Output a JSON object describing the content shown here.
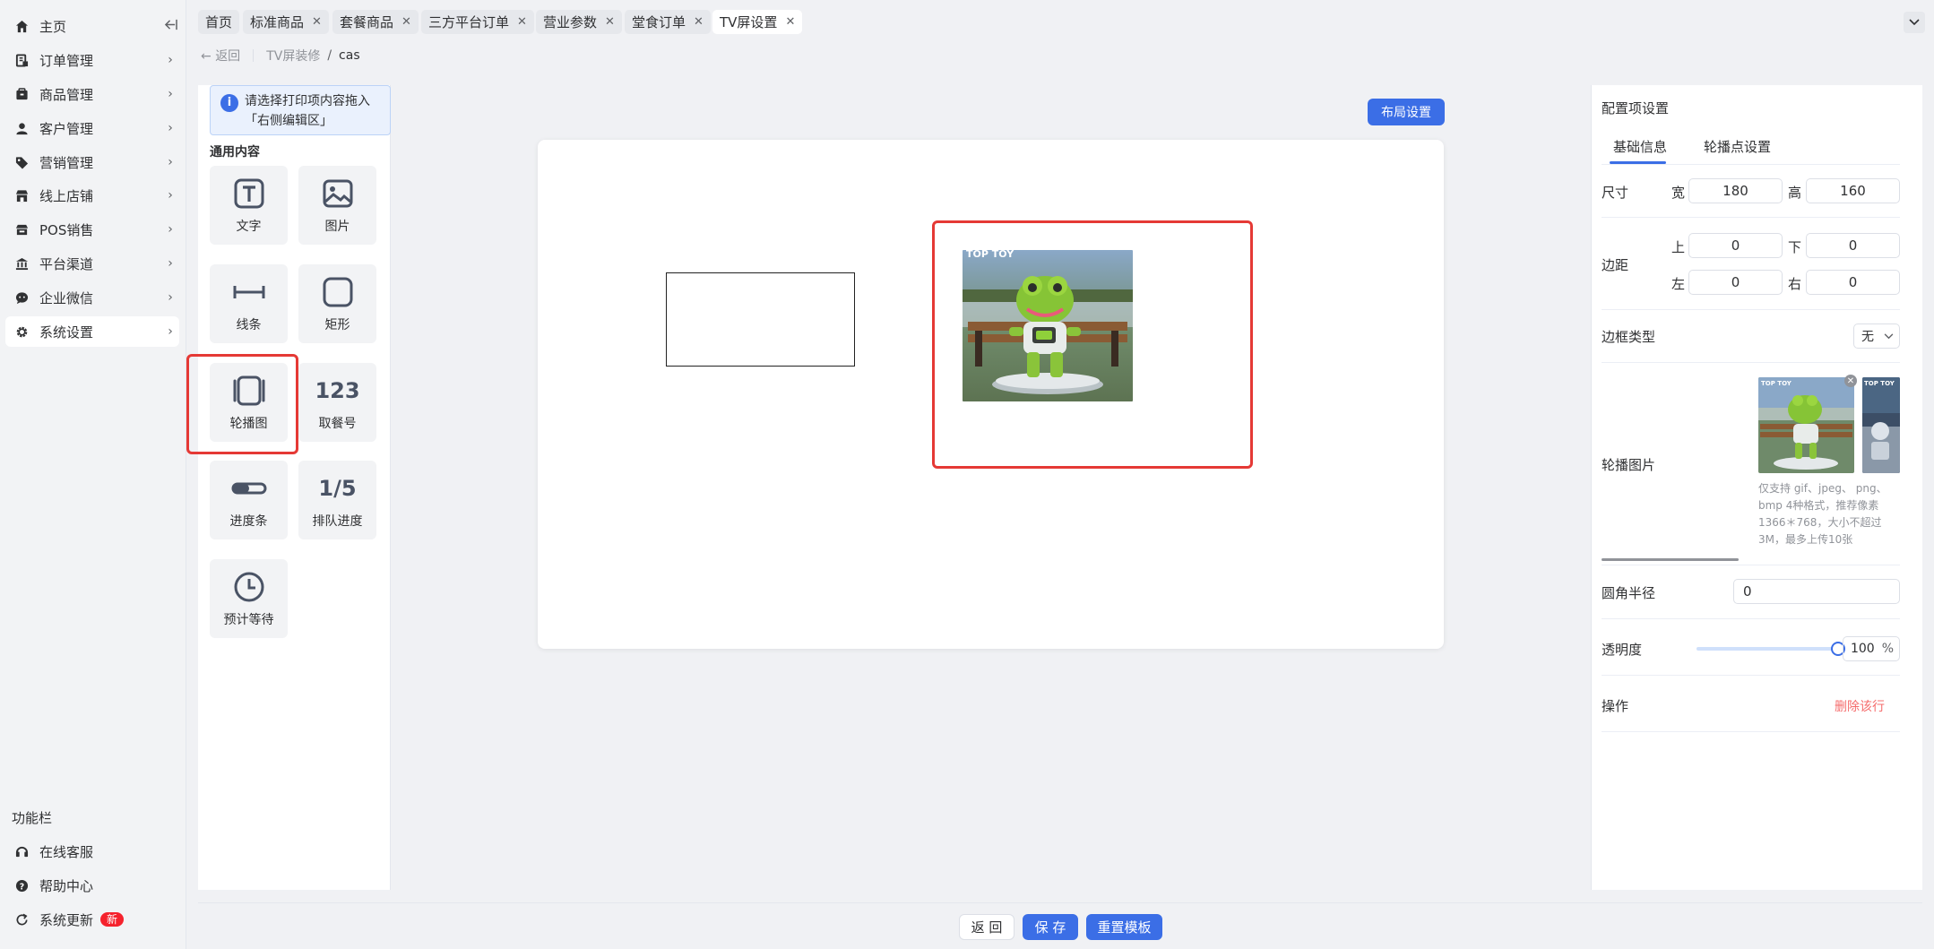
{
  "sidebar": {
    "items": [
      {
        "label": "主页",
        "icon": "home-icon"
      },
      {
        "label": "订单管理",
        "icon": "order-icon"
      },
      {
        "label": "商品管理",
        "icon": "goods-icon"
      },
      {
        "label": "客户管理",
        "icon": "user-icon"
      },
      {
        "label": "营销管理",
        "icon": "tag-icon"
      },
      {
        "label": "线上店铺",
        "icon": "store-icon"
      },
      {
        "label": "POS销售",
        "icon": "pos-icon"
      },
      {
        "label": "平台渠道",
        "icon": "bank-icon"
      },
      {
        "label": "企业微信",
        "icon": "wechat-icon"
      },
      {
        "label": "系统设置",
        "icon": "gear-icon"
      }
    ],
    "func_title": "功能栏",
    "func_items": [
      {
        "label": "在线客服"
      },
      {
        "label": "帮助中心"
      },
      {
        "label": "系统更新",
        "badge": "新"
      }
    ]
  },
  "tabs": [
    {
      "label": "首页"
    },
    {
      "label": "标准商品"
    },
    {
      "label": "套餐商品"
    },
    {
      "label": "三方平台订单"
    },
    {
      "label": "营业参数"
    },
    {
      "label": "堂食订单"
    },
    {
      "label": "TV屏设置"
    }
  ],
  "breadcrumb": {
    "back": "返回",
    "parent": "TV屏装修",
    "separator": "/",
    "current": "cas"
  },
  "components": {
    "hint": "请选择打印项内容拖入「右侧编辑区」",
    "section_title": "通用内容",
    "items": [
      {
        "label": "文字",
        "icon": "text-icon"
      },
      {
        "label": "图片",
        "icon": "image-icon"
      },
      {
        "label": "线条",
        "icon": "line-icon"
      },
      {
        "label": "矩形",
        "icon": "rectangle-icon"
      },
      {
        "label": "轮播图",
        "icon": "carousel-icon"
      },
      {
        "label": "取餐号",
        "icon": "number-icon",
        "glyph": "123"
      },
      {
        "label": "进度条",
        "icon": "progress-icon"
      },
      {
        "label": "排队进度",
        "icon": "queue-icon",
        "glyph": "1/5"
      },
      {
        "label": "预计等待",
        "icon": "clock-icon"
      }
    ]
  },
  "canvas": {
    "layout_button": "布局设置",
    "carousel_logo": "TOP TOY"
  },
  "config": {
    "title": "配置项设置",
    "tabs": [
      "基础信息",
      "轮播点设置"
    ],
    "size_label": "尺寸",
    "width_label": "宽",
    "width_value": "180",
    "height_label": "高",
    "height_value": "160",
    "margin_label": "边距",
    "margin_top_label": "上",
    "margin_top": "0",
    "margin_bottom_label": "下",
    "margin_bottom": "0",
    "margin_left_label": "左",
    "margin_left": "0",
    "margin_right_label": "右",
    "margin_right": "0",
    "border_type_label": "边框类型",
    "border_type_value": "无",
    "carousel_images_label": "轮播图片",
    "upload_hint": "仅支持 gif、jpeg、 png、bmp 4种格式，推荐像素1366＊768，大小不超过3M，最多上传10张",
    "radius_label": "圆角半径",
    "radius_value": "0",
    "opacity_label": "透明度",
    "opacity_value": "100",
    "opacity_unit": "%",
    "opacity_level": 1.0,
    "action_label": "操作",
    "delete_label": "删除该行"
  },
  "footer": {
    "back": "返 回",
    "save": "保 存",
    "reset": "重置模板"
  },
  "colors": {
    "primary": "#3b6ee6",
    "highlight": "#e53935",
    "danger": "#f56c6c",
    "badge": "#f5222d"
  }
}
